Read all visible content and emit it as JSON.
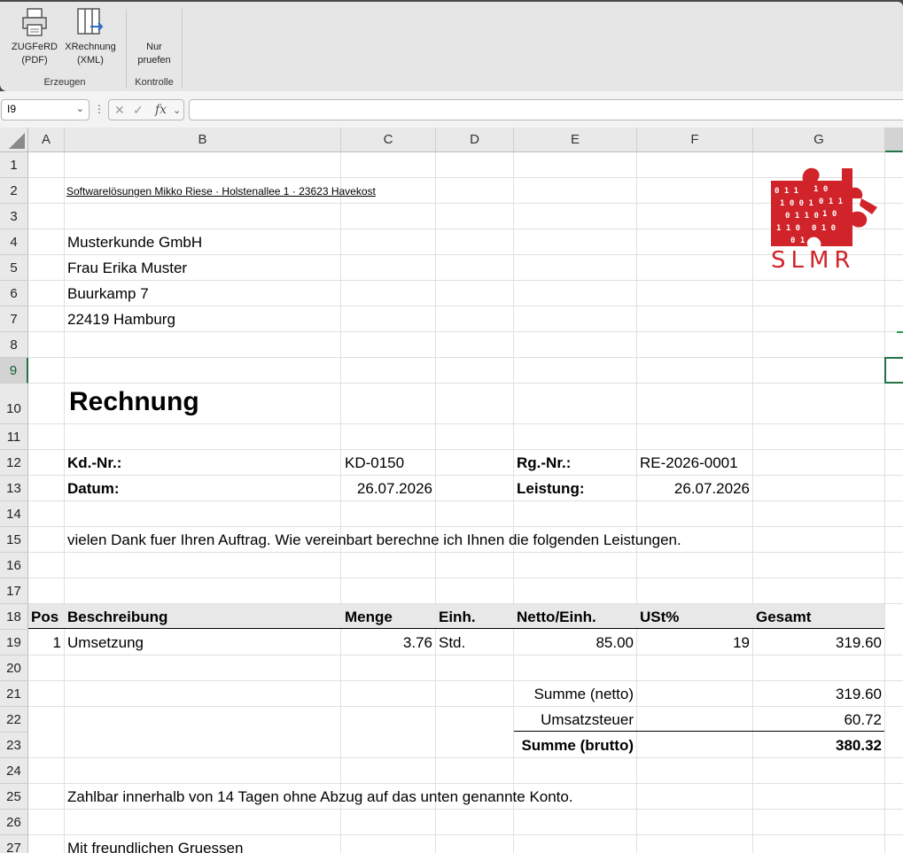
{
  "ribbon": {
    "buttons": [
      {
        "id": "zugferd",
        "label_line1": "ZUGFeRD",
        "label_line2": "(PDF)"
      },
      {
        "id": "xrechnung",
        "label_line1": "XRechnung",
        "label_line2": "(XML)"
      },
      {
        "id": "nur-pruefen",
        "label_line1": "Nur",
        "label_line2": "pruefen"
      }
    ],
    "groups": {
      "erzeugen": "Erzeugen",
      "kontrolle": "Kontrolle"
    }
  },
  "formula_bar": {
    "name_box": "I9",
    "fx": "fx"
  },
  "columns": [
    "A",
    "B",
    "C",
    "D",
    "E",
    "F",
    "G"
  ],
  "rows": [
    "1",
    "2",
    "3",
    "4",
    "5",
    "6",
    "7",
    "8",
    "9",
    "10",
    "11",
    "12",
    "13",
    "14",
    "15",
    "16",
    "17",
    "18",
    "19",
    "20",
    "21",
    "22",
    "23",
    "24",
    "25",
    "26",
    "27"
  ],
  "invoice": {
    "sender_line": "Softwarelösungen Mikko Riese · Holstenallee 1 · 23623 Havekost",
    "logo_text": "SLMR",
    "recipient": [
      "Musterkunde GmbH",
      "Frau Erika Muster",
      "Buurkamp 7",
      "22419 Hamburg"
    ],
    "title": "Rechnung",
    "kd_label": "Kd.-Nr.:",
    "kd_value": "KD-0150",
    "rg_label": "Rg.-Nr.:",
    "rg_value": "RE-2026-0001",
    "datum_label": "Datum:",
    "datum_value": "26.07.2026",
    "leistung_label": "Leistung:",
    "leistung_value": "26.07.2026",
    "intro": "vielen Dank fuer Ihren Auftrag. Wie vereinbart berechne ich Ihnen die folgenden Leistungen.",
    "table_headers": {
      "pos": "Pos",
      "beschreibung": "Beschreibung",
      "menge": "Menge",
      "einh": "Einh.",
      "netto": "Netto/Einh.",
      "ust": "USt%",
      "gesamt": "Gesamt"
    },
    "items": [
      {
        "pos": "1",
        "beschreibung": "Umsetzung",
        "menge": "3.76",
        "einh": "Std.",
        "netto": "85.00",
        "ust": "19",
        "gesamt": "319.60"
      }
    ],
    "summe_netto_label": "Summe (netto)",
    "summe_netto": "319.60",
    "ust_label": "Umsatzsteuer",
    "ust_value": "60.72",
    "summe_brutto_label": "Summe (brutto)",
    "summe_brutto": "380.32",
    "payment": "Zahlbar innerhalb von 14 Tagen ohne Abzug auf das unten genannte Konto.",
    "closing": "Mit freundlichen Gruessen"
  },
  "colors": {
    "selection": "#217346",
    "logo_red": "#d0232a",
    "header_fill": "#e8e8e8"
  }
}
